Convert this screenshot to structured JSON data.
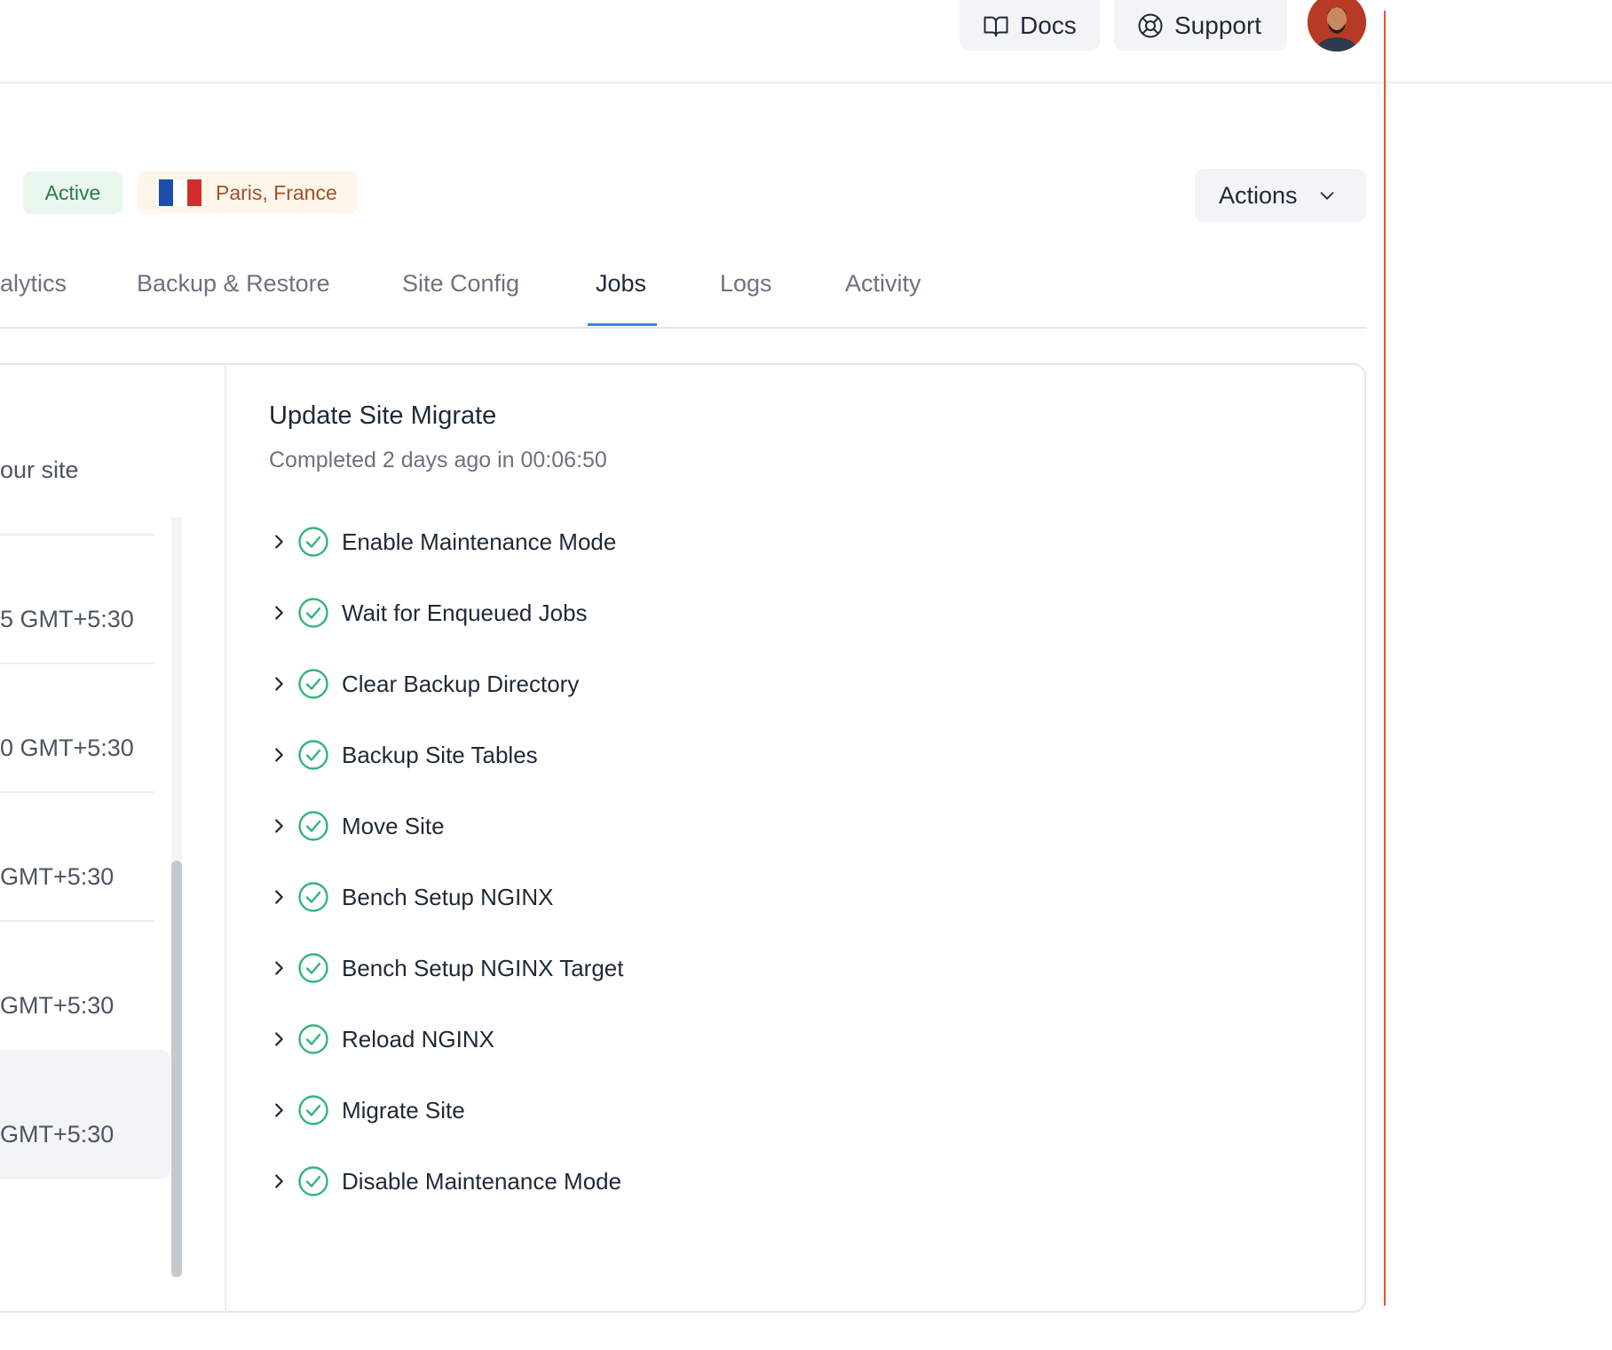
{
  "header": {
    "docs_label": "Docs",
    "support_label": "Support"
  },
  "site": {
    "status": "Active",
    "location": "Paris, France",
    "actions_label": "Actions"
  },
  "tabs": [
    {
      "label": "alytics"
    },
    {
      "label": "Backup & Restore"
    },
    {
      "label": "Site Config"
    },
    {
      "label": "Jobs"
    },
    {
      "label": "Logs"
    },
    {
      "label": "Activity"
    }
  ],
  "active_tab": "Jobs",
  "job_list": {
    "subtitle": "our site",
    "items": [
      {
        "time": "5 GMT+5:30"
      },
      {
        "time": "0 GMT+5:30"
      },
      {
        "time": "GMT+5:30"
      },
      {
        "time": "GMT+5:30"
      },
      {
        "time": "GMT+5:30"
      }
    ]
  },
  "job": {
    "title": "Update Site Migrate",
    "meta": "Completed 2 days ago in 00:06:50",
    "steps": [
      {
        "label": "Enable Maintenance Mode",
        "status": "success"
      },
      {
        "label": "Wait for Enqueued Jobs",
        "status": "success"
      },
      {
        "label": "Clear Backup Directory",
        "status": "success"
      },
      {
        "label": "Backup Site Tables",
        "status": "success"
      },
      {
        "label": "Move Site",
        "status": "success"
      },
      {
        "label": "Bench Setup NGINX",
        "status": "success"
      },
      {
        "label": "Bench Setup NGINX Target",
        "status": "success"
      },
      {
        "label": "Reload NGINX",
        "status": "success"
      },
      {
        "label": "Migrate Site",
        "status": "success"
      },
      {
        "label": "Disable Maintenance Mode",
        "status": "success"
      }
    ]
  },
  "colors": {
    "success": "#34b47a",
    "tab_active_underline": "#3b82f6",
    "status_badge_bg": "#eaf7ef",
    "status_badge_text": "#2c7a4b",
    "location_badge_bg": "#fdf6e9",
    "location_badge_text": "#a0522d"
  }
}
